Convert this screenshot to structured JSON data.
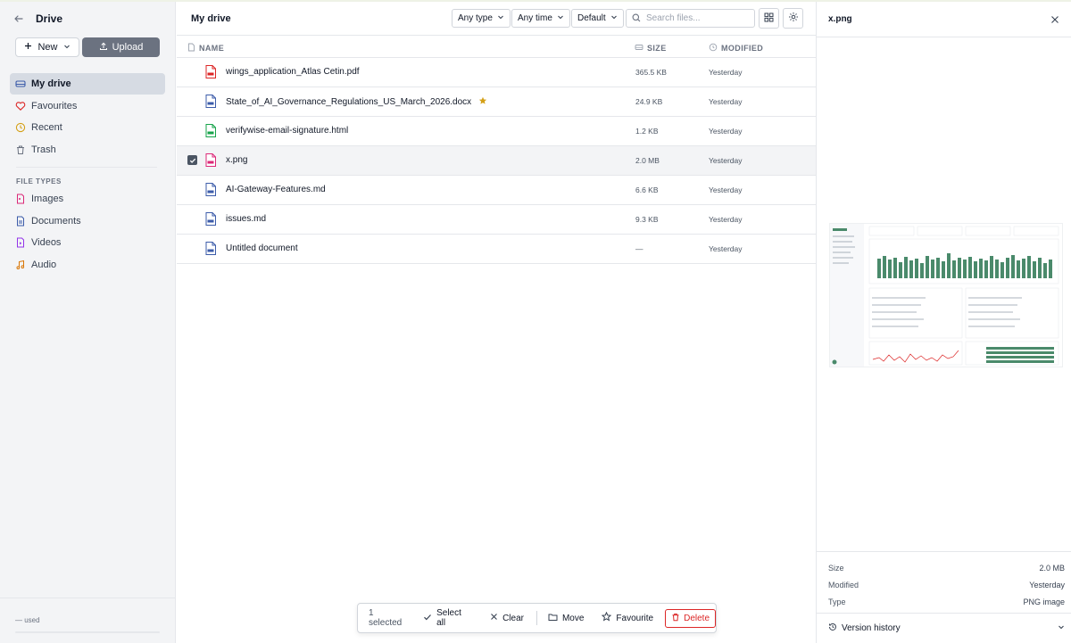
{
  "sidebar": {
    "title": "Drive",
    "new_label": "New",
    "upload_label": "Upload",
    "nav": [
      {
        "label": "My drive",
        "icon": "drive-icon",
        "active": true
      },
      {
        "label": "Favourites",
        "icon": "heart-icon"
      },
      {
        "label": "Recent",
        "icon": "clock-icon"
      },
      {
        "label": "Trash",
        "icon": "trash-icon"
      }
    ],
    "file_types_label": "FILE TYPES",
    "file_types": [
      {
        "label": "Images",
        "icon": "image-file-icon"
      },
      {
        "label": "Documents",
        "icon": "document-file-icon"
      },
      {
        "label": "Videos",
        "icon": "video-file-icon"
      },
      {
        "label": "Audio",
        "icon": "music-icon"
      }
    ],
    "usage": "— used"
  },
  "main": {
    "title": "My drive",
    "filters": {
      "type": "Any type",
      "time": "Any time",
      "sort": "Default"
    },
    "search_placeholder": "Search files...",
    "columns": {
      "name": "NAME",
      "size": "SIZE",
      "modified": "MODIFIED"
    },
    "files": [
      {
        "name": "wings_application_Atlas Cetin.pdf",
        "size": "365.5 KB",
        "modified": "Yesterday",
        "kind": "pdf"
      },
      {
        "name": "State_of_AI_Governance_Regulations_US_March_2026.docx",
        "size": "24.9 KB",
        "modified": "Yesterday",
        "kind": "docx",
        "starred": true
      },
      {
        "name": "verifywise-email-signature.html",
        "size": "1.2 KB",
        "modified": "Yesterday",
        "kind": "html"
      },
      {
        "name": "x.png",
        "size": "2.0 MB",
        "modified": "Yesterday",
        "kind": "png",
        "selected": true
      },
      {
        "name": "AI-Gateway-Features.md",
        "size": "6.6 KB",
        "modified": "Yesterday",
        "kind": "md"
      },
      {
        "name": "issues.md",
        "size": "9.3 KB",
        "modified": "Yesterday",
        "kind": "md"
      },
      {
        "name": "Untitled document",
        "size": "—",
        "modified": "Yesterday",
        "kind": "doc"
      }
    ]
  },
  "actionbar": {
    "count": "1 selected",
    "select_all": "Select all",
    "clear": "Clear",
    "move": "Move",
    "favourite": "Favourite",
    "delete": "Delete"
  },
  "panel": {
    "title": "x.png",
    "meta": [
      {
        "key": "Size",
        "value": "2.0 MB"
      },
      {
        "key": "Modified",
        "value": "Yesterday"
      },
      {
        "key": "Type",
        "value": "PNG image"
      }
    ],
    "version_history": "Version history"
  },
  "colors": {
    "pdf": "#dc2626",
    "docx": "#3b5ba9",
    "html": "#16a34a",
    "png": "#db2777",
    "md": "#3b5ba9",
    "doc": "#3b5ba9",
    "star": "#d4a017",
    "delete": "#dc2626",
    "preview_bars": "#4a8a6b"
  }
}
